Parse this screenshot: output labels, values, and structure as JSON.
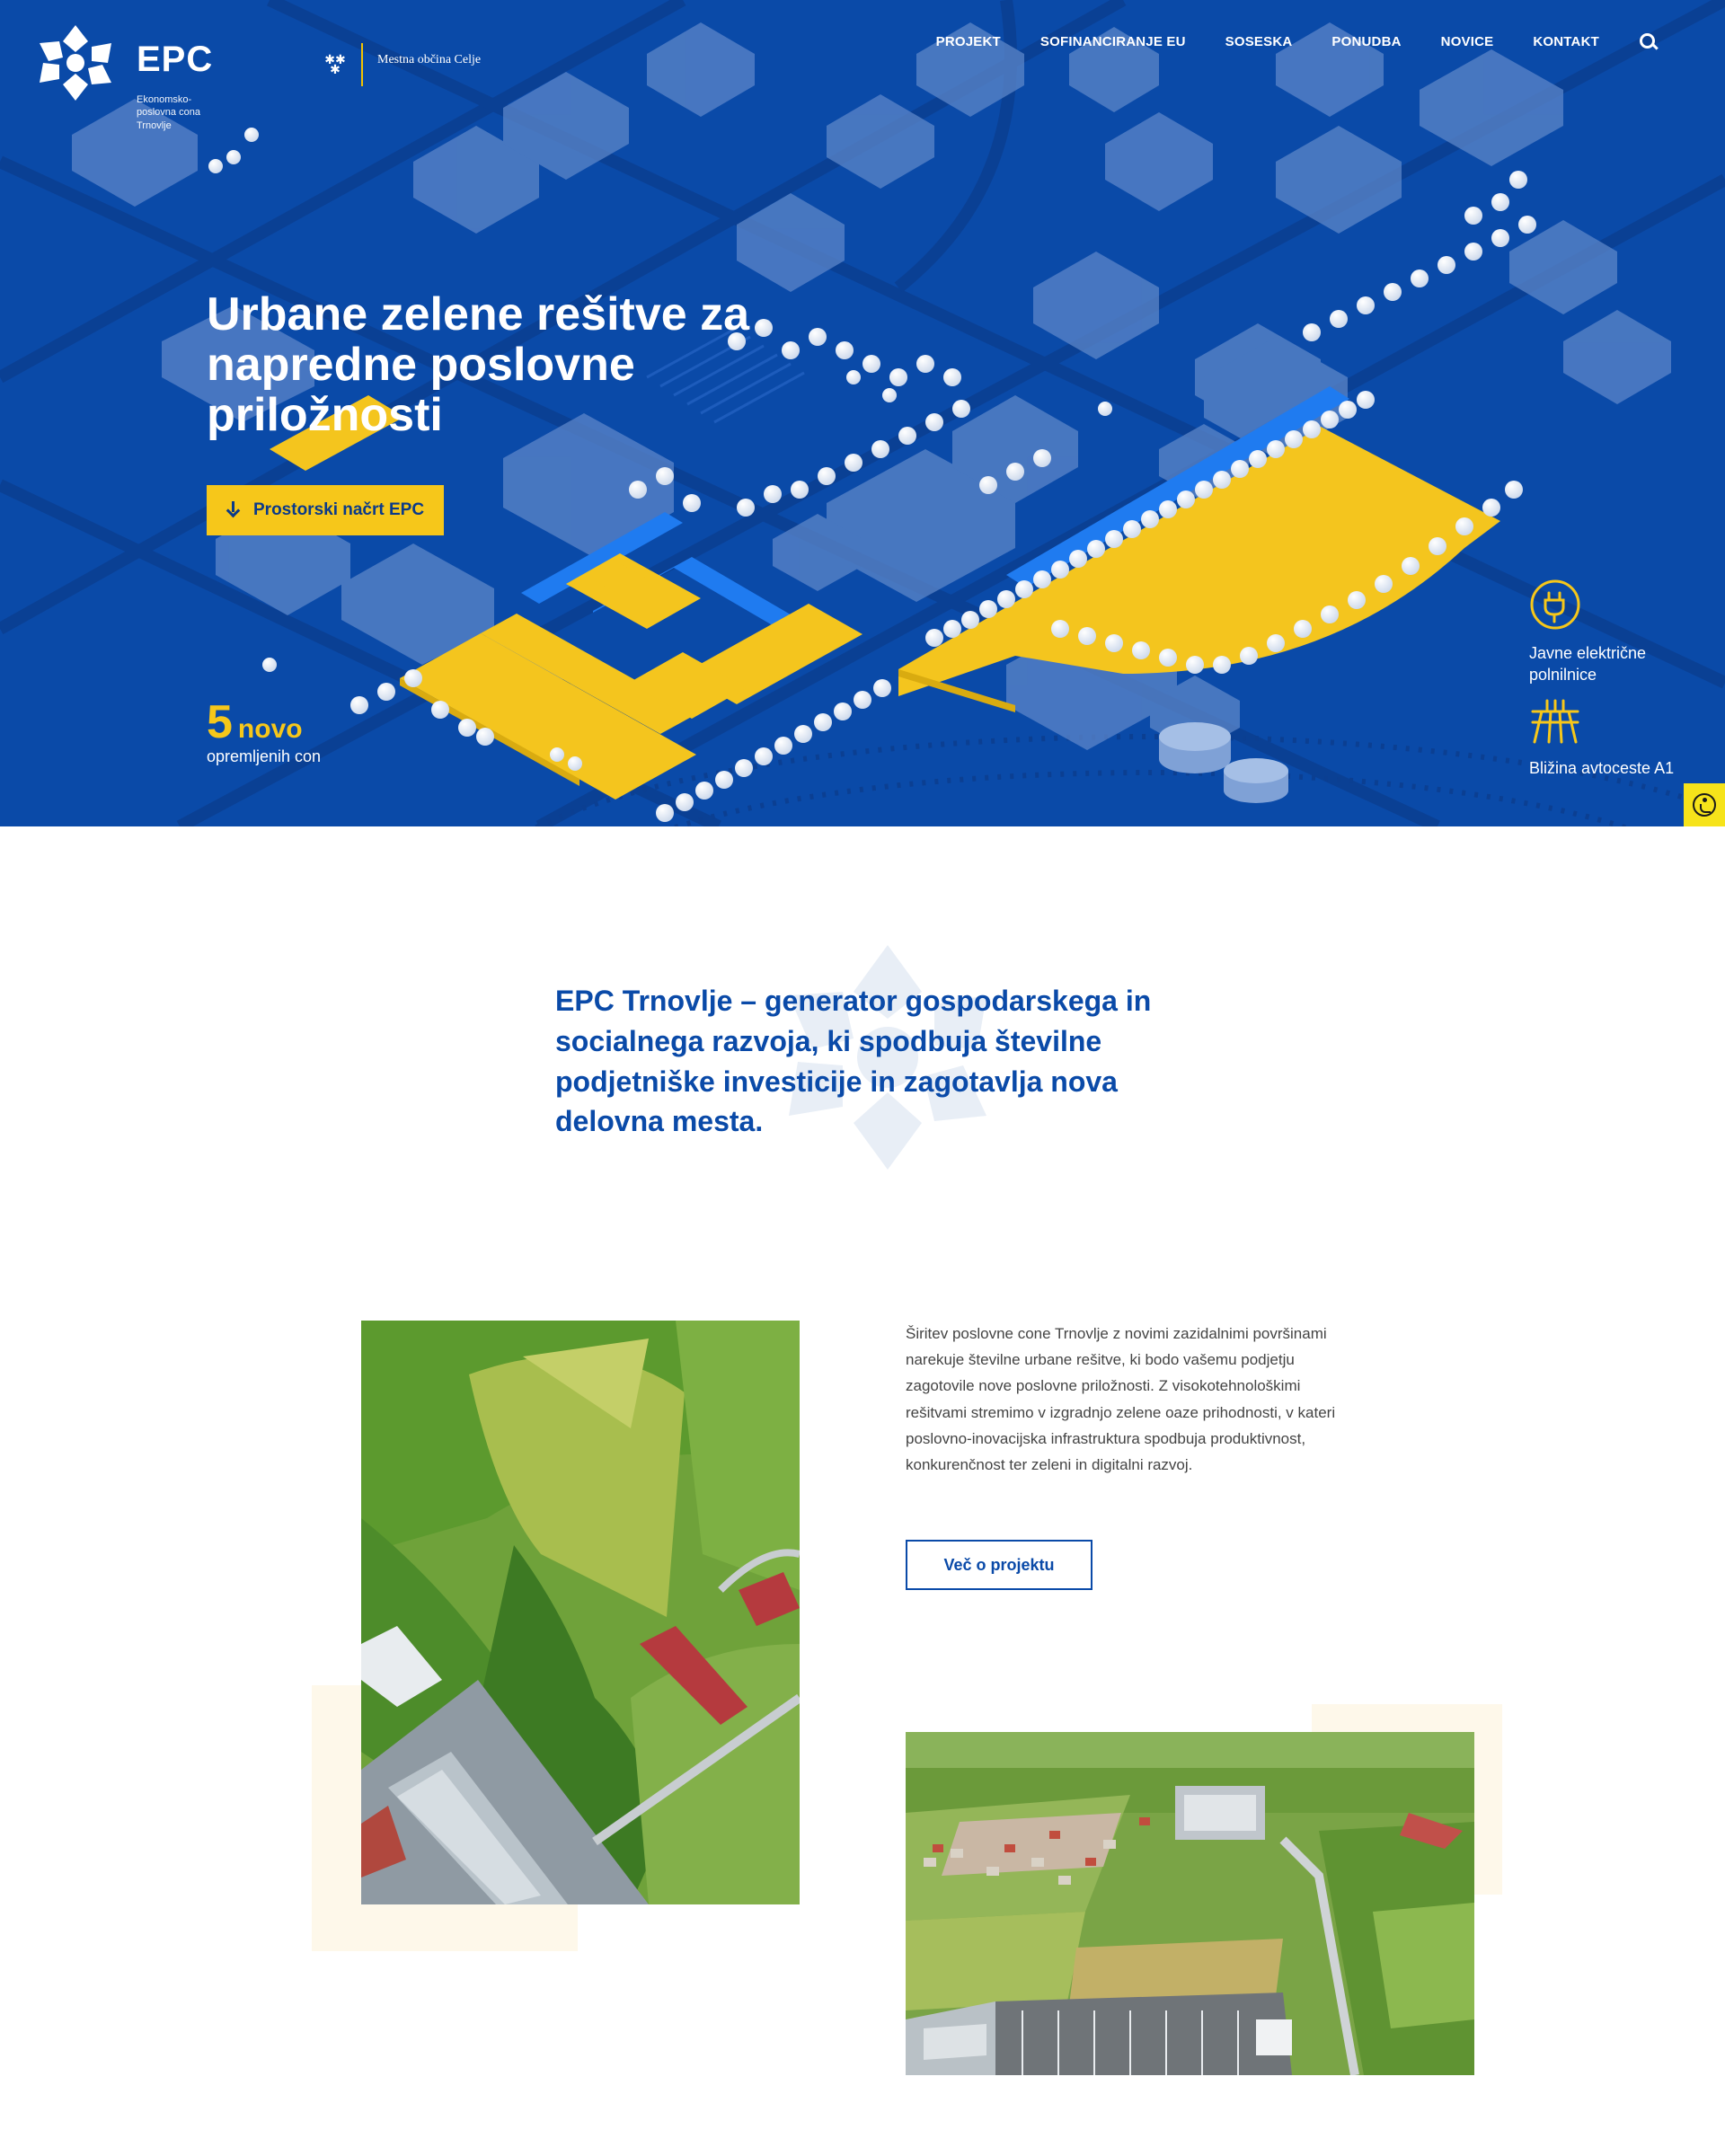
{
  "header": {
    "logo_name": "EPC",
    "logo_subtitle": "Ekonomsko-poslovna cona Trnovlje",
    "municipality": "Mestna občina Celje",
    "nav": [
      "PROJEKT",
      "SOFINANCIRANJE EU",
      "SOSESKA",
      "PONUDBA",
      "NOVICE",
      "KONTAKT"
    ],
    "search_icon": "search-icon"
  },
  "hero": {
    "title": "Urbane zelene rešitve za napredne poslovne priložnosti",
    "button_label": "Prostorski načrt EPC",
    "stat_number": "5",
    "stat_word": "novo",
    "stat_label": "opremljenih con",
    "features": [
      {
        "icon": "ev-charger-icon",
        "label": "Javne električne polnilnice"
      },
      {
        "icon": "highway-icon",
        "label": "Bližina avtoceste A1"
      }
    ],
    "colors": {
      "blue": "#0a4aa8",
      "yellow": "#f6c71a"
    }
  },
  "intro": {
    "text": "EPC Trnovlje – generator gospodarskega in socialnega razvoja, ki spodbuja številne podjetniške investicije in zagotavlja nova delovna mesta."
  },
  "project": {
    "description": "Širitev poslovne cone Trnovlje z novimi zazidalnimi površinami narekuje številne urbane rešitve, ki bodo vašemu podjetju zagotovile nove poslovne priložnosti. Z visokotehnološkimi rešitvami stremimo v izgradnjo zelene oaze prihodnosti, v kateri poslovno-inovacijska infrastruktura spodbuja produktivnost, konkurenčnost ter zeleni in digitalni razvoj.",
    "button_label": "Več o projektu"
  }
}
